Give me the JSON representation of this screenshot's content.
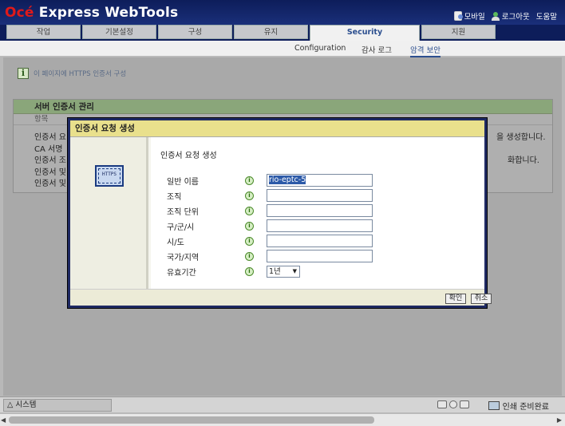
{
  "header": {
    "brand": "Océ",
    "title": "Express WebTools",
    "links": {
      "mobile": "모바일",
      "logout": "로그아웃",
      "help": "도움말"
    }
  },
  "tabs": [
    "작업",
    "기본설정",
    "구성",
    "유지",
    "Security",
    "지원"
  ],
  "subnav": {
    "configuration": "Configuration",
    "audit": "감사 로그",
    "security": "암격 보안"
  },
  "info_text": "이 페이지에 HTTPS 인증서 구성",
  "panel": {
    "title": "서버 인증서 관리",
    "subhead": "항목",
    "rows": [
      "인증서 요",
      "CA 서명",
      "인증서 조",
      "인증서 및",
      "인증서 및"
    ],
    "right_1": "을 생성합니다.",
    "right_2": "화합니다."
  },
  "dialog": {
    "title": "인증서 요청 생성",
    "heading": "인증서 요청 생성",
    "cert_icon_text": "HTTPS",
    "fields": [
      {
        "label": "일반 이름",
        "value": "rio-eptc-5"
      },
      {
        "label": "조직",
        "value": ""
      },
      {
        "label": "조직 단위",
        "value": ""
      },
      {
        "label": "구/군/시",
        "value": ""
      },
      {
        "label": "시/도",
        "value": ""
      },
      {
        "label": "국가/지역",
        "value": ""
      }
    ],
    "validity": {
      "label": "유효기간",
      "value": "1년"
    },
    "buttons": {
      "ok": "확인",
      "cancel": "취소"
    }
  },
  "status": {
    "system": "△ 시스템",
    "print_status": "인쇄 준비완료"
  }
}
